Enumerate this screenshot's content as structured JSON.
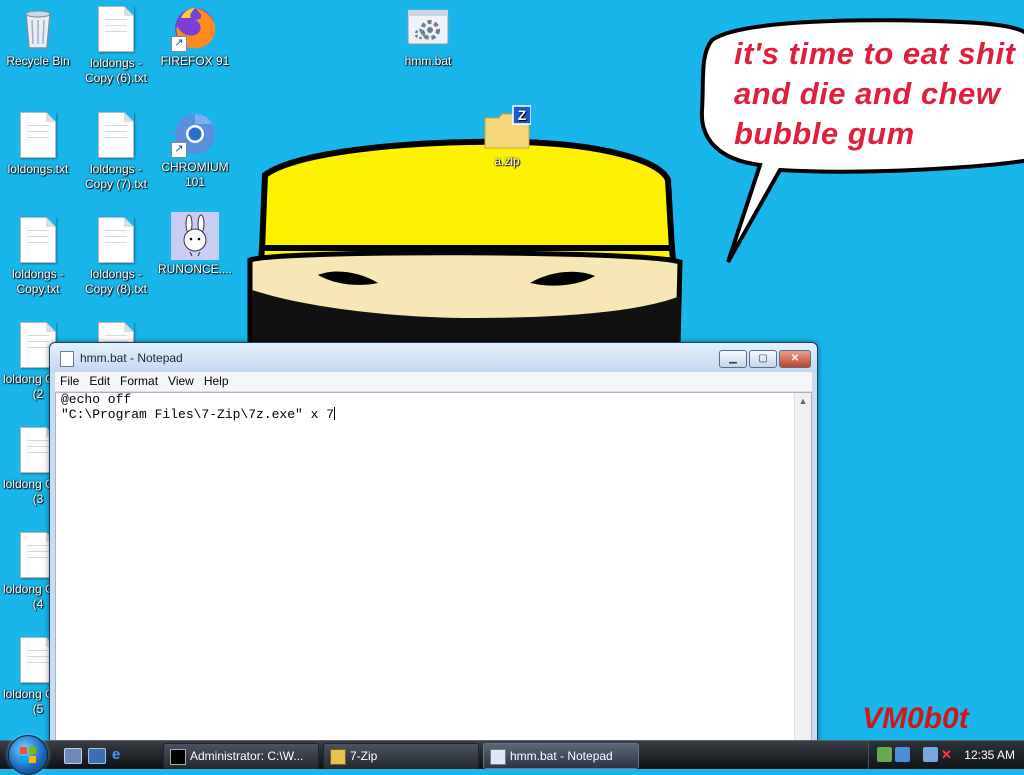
{
  "desktop": {
    "icons": [
      {
        "label": "Recycle Bin"
      },
      {
        "label": "loldongs - Copy (6).txt"
      },
      {
        "label": "FIREFOX 91"
      },
      {
        "label": "hmm.bat"
      },
      {
        "label": "loldongs.txt"
      },
      {
        "label": "loldongs - Copy (7).txt"
      },
      {
        "label": "CHROMIUM 101"
      },
      {
        "label": "a.zip"
      },
      {
        "label": "loldongs - Copy.txt"
      },
      {
        "label": "loldongs - Copy (8).txt"
      },
      {
        "label": "RUNONCE...."
      },
      {
        "label": "loldong Copy (2"
      },
      {
        "label": "loldong Copy (3"
      },
      {
        "label": "loldong Copy (4"
      },
      {
        "label": "loldong Copy (5"
      }
    ],
    "wallpaper_text": {
      "speech": "it's time to eat shit and die and chew bubble gum",
      "signature": "VM0b0t"
    }
  },
  "notepad": {
    "title": "hmm.bat - Notepad",
    "menu": [
      "File",
      "Edit",
      "Format",
      "View",
      "Help"
    ],
    "lines": [
      "@echo off",
      "\"C:\\Program Files\\7-Zip\\7z.exe\" x 7"
    ]
  },
  "taskbar": {
    "tasks": [
      {
        "label": "Administrator: C:\\W..."
      },
      {
        "label": "7-Zip"
      },
      {
        "label": "hmm.bat - Notepad"
      }
    ],
    "clock": "12:35 AM"
  },
  "colors": {
    "desktop_bg": "#18b6ea",
    "speech_text": "#e0203a",
    "hat": "#fff200"
  }
}
